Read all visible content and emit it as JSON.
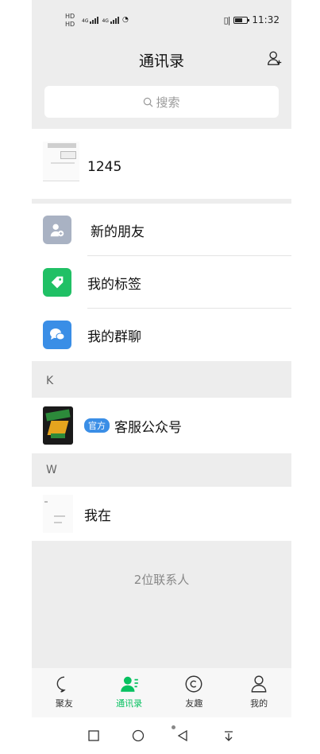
{
  "status_bar": {
    "sim1": "HD",
    "sim2": "HD",
    "net1": "4G",
    "net2": "4G",
    "time": "11:32"
  },
  "header": {
    "title": "通讯录",
    "search_placeholder": "搜索"
  },
  "top_contact": {
    "name": "1245"
  },
  "features": [
    {
      "label": "新的朋友",
      "icon": "new-friend-icon",
      "color": "#a9b2c3"
    },
    {
      "label": "我的标签",
      "icon": "tag-icon",
      "color": "#20c065"
    },
    {
      "label": "我的群聊",
      "icon": "group-chat-icon",
      "color": "#3a8ee6"
    }
  ],
  "sections": [
    {
      "letter": "K",
      "contacts": [
        {
          "badge": "官方",
          "name": "客服公众号"
        }
      ]
    },
    {
      "letter": "W",
      "contacts": [
        {
          "name": "我在"
        }
      ]
    }
  ],
  "footer": {
    "contact_count": "2位联系人"
  },
  "tabs": [
    {
      "label": "聚友",
      "icon": "chat-icon",
      "active": false
    },
    {
      "label": "通讯录",
      "icon": "contacts-icon",
      "active": true
    },
    {
      "label": "友趣",
      "icon": "discover-icon",
      "active": false
    },
    {
      "label": "我的",
      "icon": "profile-icon",
      "active": false
    }
  ],
  "colors": {
    "accent": "#07c160",
    "background": "#ededed",
    "official_badge": "#3a8ee6"
  }
}
